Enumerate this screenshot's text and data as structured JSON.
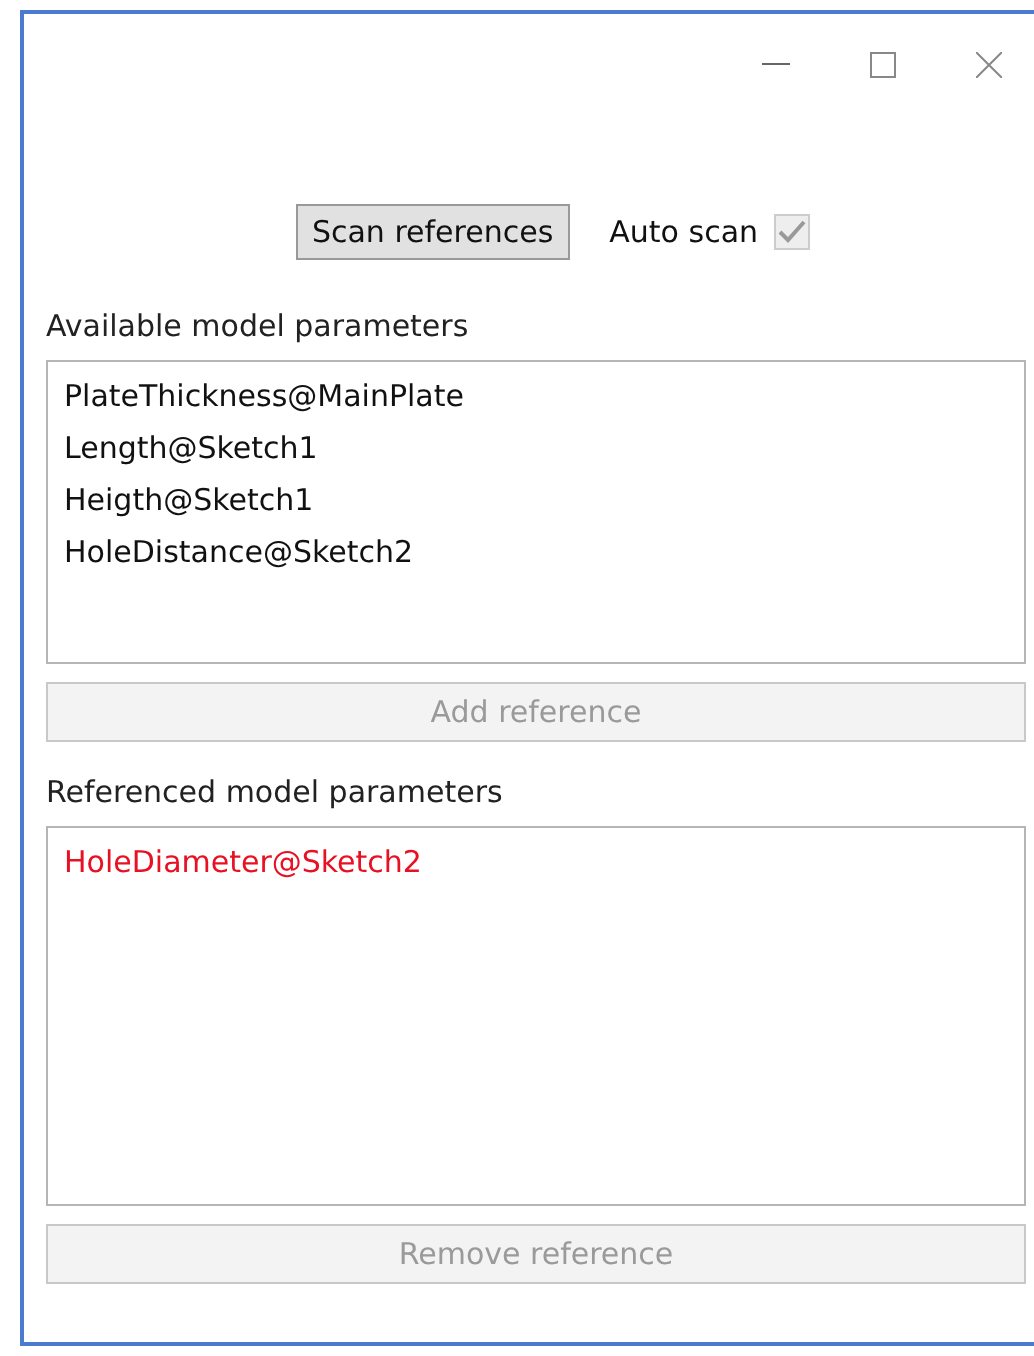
{
  "toolbar": {
    "scan_button": "Scan references",
    "auto_scan": {
      "label": "Auto scan",
      "checked": true,
      "disabled": true
    }
  },
  "available": {
    "heading": "Available model parameters",
    "items": [
      {
        "label": "PlateThickness@MainPlate"
      },
      {
        "label": "Length@Sketch1"
      },
      {
        "label": "Heigth@Sketch1"
      },
      {
        "label": "HoleDistance@Sketch2"
      }
    ],
    "button": {
      "label": "Add reference",
      "disabled": true
    }
  },
  "referenced": {
    "heading": "Referenced model parameters",
    "items": [
      {
        "label": "HoleDiameter@Sketch2",
        "color": "#e81123"
      }
    ],
    "button": {
      "label": "Remove reference",
      "disabled": true
    }
  }
}
